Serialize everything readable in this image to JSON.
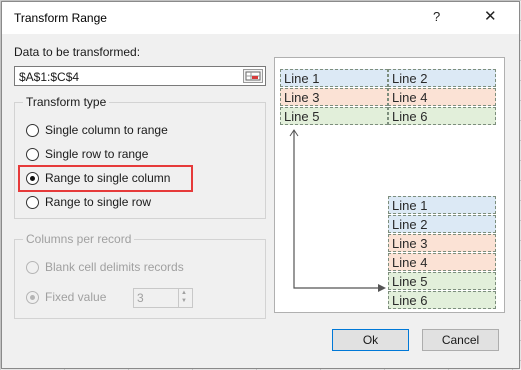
{
  "dialog": {
    "title": "Transform Range",
    "help_glyph": "?",
    "close_glyph": "✕"
  },
  "data_section": {
    "label": "Data to be transformed:",
    "range_value": "$A$1:$C$4",
    "range_picker_icon": "range-selector-icon"
  },
  "transform_type": {
    "title": "Transform type",
    "options": [
      {
        "label": "Single column to range",
        "selected": false
      },
      {
        "label": "Single row to range",
        "selected": false
      },
      {
        "label": "Range to single column",
        "selected": true
      },
      {
        "label": "Range to single row",
        "selected": false
      }
    ]
  },
  "columns_per_record": {
    "title": "Columns per record",
    "blank_cell_label": "Blank cell delimits records",
    "fixed_value_label": "Fixed value",
    "fixed_value": "3"
  },
  "preview": {
    "source_rows": [
      [
        "Line 1",
        "Line 2"
      ],
      [
        "Line 3",
        "Line 4"
      ],
      [
        "Line 5",
        "Line 6"
      ]
    ],
    "result": [
      "Line 1",
      "Line 2",
      "Line 3",
      "Line 4",
      "Line 5",
      "Line 6"
    ],
    "row_colors": [
      "#dce9f5",
      "#fbe2d5",
      "#e2efda"
    ]
  },
  "buttons": {
    "ok": "Ok",
    "cancel": "Cancel"
  }
}
